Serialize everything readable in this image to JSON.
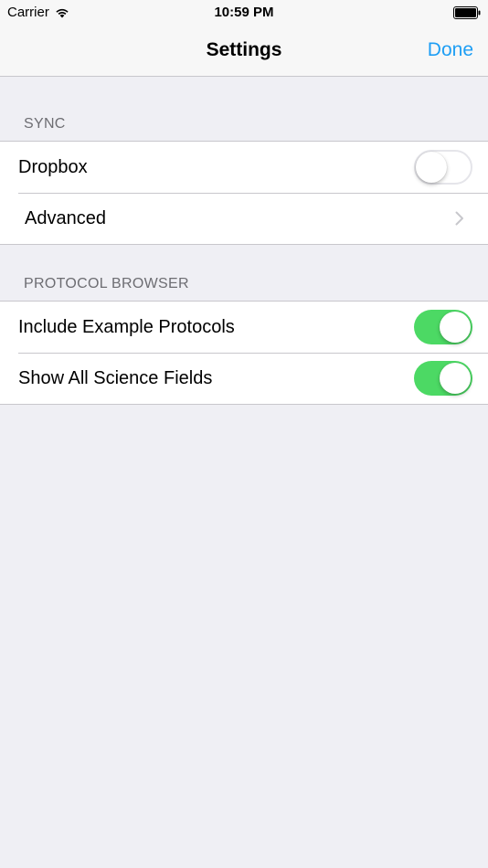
{
  "status_bar": {
    "carrier": "Carrier",
    "time": "10:59 PM"
  },
  "nav": {
    "title": "Settings",
    "done_label": "Done"
  },
  "sections": [
    {
      "header": "SYNC",
      "rows": [
        {
          "label": "Dropbox",
          "control": "switch",
          "on": false
        },
        {
          "label": "Advanced",
          "control": "disclosure"
        }
      ]
    },
    {
      "header": "PROTOCOL BROWSER",
      "rows": [
        {
          "label": "Include Example Protocols",
          "control": "switch",
          "on": true
        },
        {
          "label": "Show All Science Fields",
          "control": "switch",
          "on": true
        }
      ]
    }
  ],
  "colors": {
    "accent": "#1e9ef4",
    "switch_on": "#4cd964",
    "background": "#efeff4"
  }
}
